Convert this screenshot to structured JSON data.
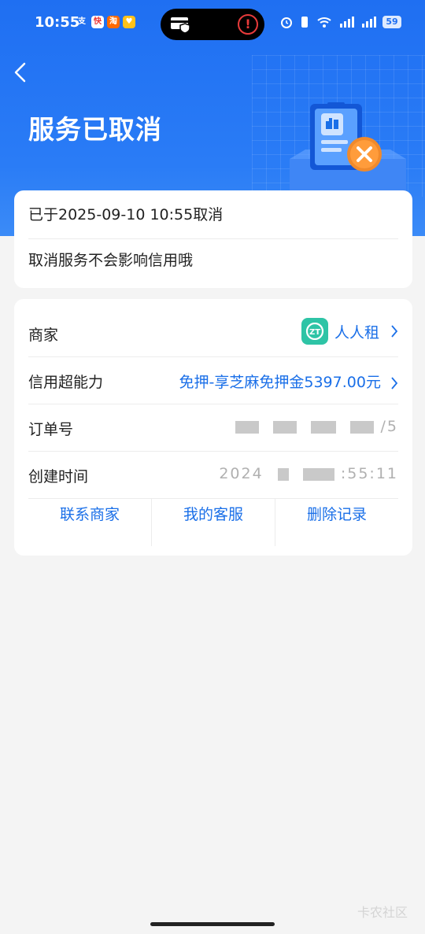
{
  "status_bar": {
    "time": "10:55",
    "battery": "59",
    "app_icons": [
      "支",
      "快",
      "淘",
      "♥"
    ]
  },
  "header": {
    "title": "服务已取消"
  },
  "cancel_card": {
    "cancel_time_text": "已于2025-09-10 10:55取消",
    "note": "取消服务不会影响信用哦"
  },
  "order_card": {
    "merchant": {
      "label": "商家",
      "value": "人人租",
      "logo_text": "ZT"
    },
    "credit": {
      "label": "信用超能力",
      "value": "免押-享芝麻免押金5397.00元"
    },
    "order_no": {
      "label": "订单号",
      "value_partial": "/5"
    },
    "created": {
      "label": "创建时间",
      "value_start": "2024",
      "value_end": ":55:11"
    }
  },
  "actions": {
    "contact_merchant": "联系商家",
    "my_service": "我的客服",
    "delete_record": "删除记录"
  },
  "watermark": "卡农社区",
  "colors": {
    "header_blue": "#1f6ff2",
    "link_blue": "#1a6fe8",
    "orange": "#f08a2c"
  }
}
